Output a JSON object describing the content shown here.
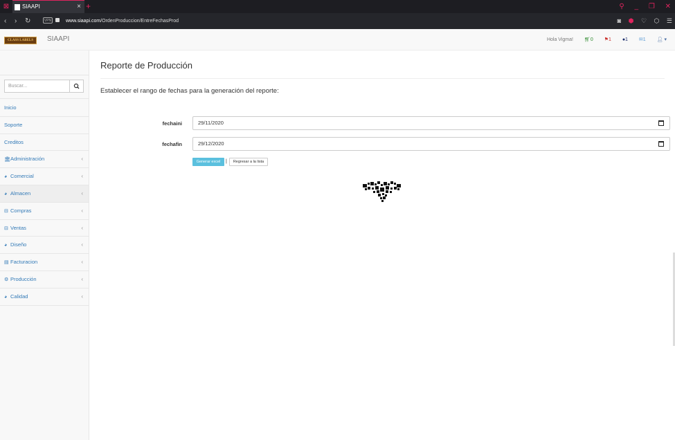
{
  "browser": {
    "tab_title": "SIAAPI",
    "close_glyph": "×",
    "newtab_glyph": "+",
    "url_host": "www.siaapi.com",
    "url_path": "/OrdenProduccion/EntreFechasProd",
    "vpn_label": "VPN"
  },
  "navbar": {
    "logo_text": "CLASS LABELS",
    "brand": "SIAAPI",
    "greeting": "Hola Vigma!",
    "cart_count": "0",
    "flag_count": "1",
    "comment_count": "1",
    "mail_count": "1"
  },
  "sidebar": {
    "search_placeholder": "Buscar...",
    "items": [
      {
        "label": "Inicio",
        "icon": "",
        "chevron": ""
      },
      {
        "label": "Soporte",
        "icon": "",
        "chevron": ""
      },
      {
        "label": "Creditos",
        "icon": "",
        "chevron": ""
      },
      {
        "label": "Administración",
        "icon": "bank-icon",
        "chevron": "‹"
      },
      {
        "label": "Comercial",
        "icon": "dashboard-icon",
        "chevron": "‹"
      },
      {
        "label": "Almacen",
        "icon": "dashboard-icon",
        "chevron": "‹"
      },
      {
        "label": "Compras",
        "icon": "basket-icon",
        "chevron": "‹"
      },
      {
        "label": "Ventas",
        "icon": "basket-icon",
        "chevron": "‹"
      },
      {
        "label": "Diseño",
        "icon": "dashboard-icon",
        "chevron": "‹"
      },
      {
        "label": "Facturacion",
        "icon": "document-icon",
        "chevron": "‹"
      },
      {
        "label": "Producción",
        "icon": "cogs-icon",
        "chevron": "‹"
      },
      {
        "label": "Calidad",
        "icon": "dashboard-icon",
        "chevron": "‹"
      }
    ]
  },
  "main": {
    "title": "Reporte de Producción",
    "intro": "Establecer el rango de fechas para la generación del reporte:",
    "fechaini_label": "fechaini",
    "fechaini_value": "29/11/2020",
    "fechafin_label": "fechafin",
    "fechafin_value": "29/12/2020",
    "generate_button": "Generar excel",
    "separator": "|",
    "back_button": "Regresar a la lista"
  },
  "colors": {
    "accent": "#e0245e",
    "link": "#337ab7",
    "primary_button": "#5bc0de"
  }
}
